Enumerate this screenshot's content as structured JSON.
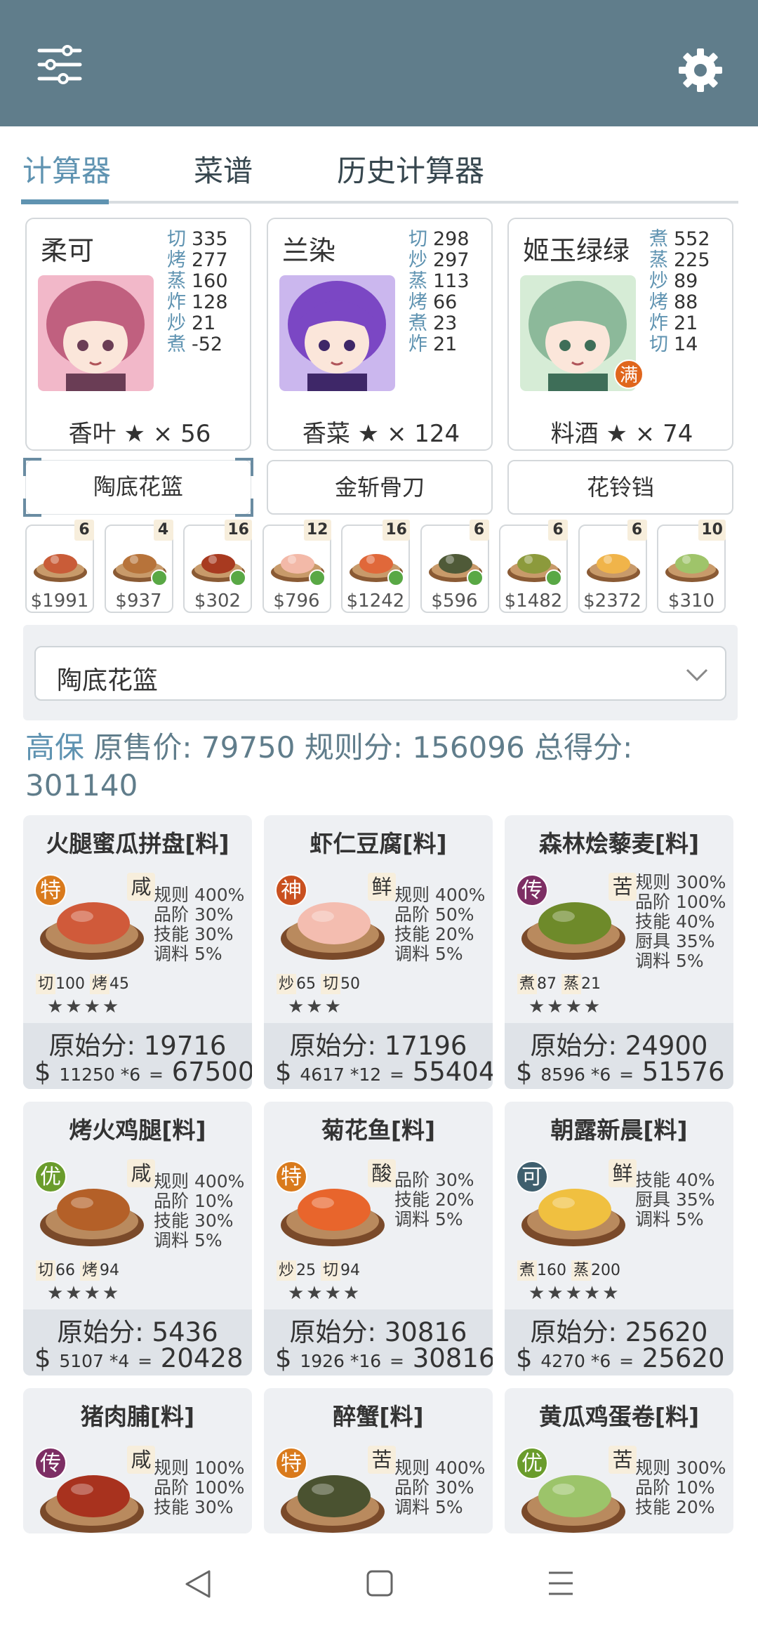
{
  "tabs": [
    "计算器",
    "菜谱",
    "历史计算器"
  ],
  "chefs": [
    {
      "name": "柔可",
      "skills": [
        [
          "切",
          "335"
        ],
        [
          "烤",
          "277"
        ],
        [
          "蒸",
          "160"
        ],
        [
          "炸",
          "128"
        ],
        [
          "炒",
          "21"
        ],
        [
          "煮",
          "-52"
        ]
      ],
      "bottom": "香叶 ★ × 56",
      "colors": [
        "#f2b8c9",
        "#c0607f",
        "#6a3d55"
      ]
    },
    {
      "name": "兰染",
      "skills": [
        [
          "切",
          "298"
        ],
        [
          "炒",
          "297"
        ],
        [
          "蒸",
          "113"
        ],
        [
          "烤",
          "66"
        ],
        [
          "煮",
          "23"
        ],
        [
          "炸",
          "21"
        ]
      ],
      "bottom": "香菜 ★ × 124",
      "colors": [
        "#cbb7ee",
        "#7b47c4",
        "#3e2768"
      ]
    },
    {
      "name": "姬玉绿绿",
      "skills": [
        [
          "煮",
          "552"
        ],
        [
          "蒸",
          "225"
        ],
        [
          "炒",
          "89"
        ],
        [
          "烤",
          "88"
        ],
        [
          "炸",
          "21"
        ],
        [
          "切",
          "14"
        ]
      ],
      "bottom": "料酒 ★ × 74",
      "colors": [
        "#d6ecd6",
        "#8cb99a",
        "#3e6e58"
      ],
      "badge": "满"
    }
  ],
  "tools": [
    "陶底花篮",
    "金斩骨刀",
    "花铃铛"
  ],
  "dishes": [
    {
      "count": "6",
      "price": "$1991",
      "color": "#c95c38",
      "ok": false
    },
    {
      "count": "4",
      "price": "$937",
      "color": "#b7733a",
      "ok": true
    },
    {
      "count": "16",
      "price": "$302",
      "color": "#a83a20",
      "ok": true
    },
    {
      "count": "12",
      "price": "$796",
      "color": "#f3b9a8",
      "ok": true
    },
    {
      "count": "16",
      "price": "$1242",
      "color": "#e0683a",
      "ok": true
    },
    {
      "count": "6",
      "price": "$596",
      "color": "#4f5a38",
      "ok": true
    },
    {
      "count": "6",
      "price": "$1482",
      "color": "#8c9a3c",
      "ok": true
    },
    {
      "count": "6",
      "price": "$2372",
      "color": "#f0b44a",
      "ok": false
    },
    {
      "count": "10",
      "price": "$310",
      "color": "#9fc46a",
      "ok": false
    }
  ],
  "select": {
    "value": "陶底花篮"
  },
  "summary": {
    "prefix": "高保",
    "orig_label": "原售价:",
    "orig": "79750",
    "rule_label": "规则分:",
    "rule": "156096",
    "total_label": "总得分:",
    "total": "301140"
  },
  "recipes": [
    {
      "title": "火腿蜜瓜拼盘[料]",
      "rarity": "特",
      "rcolor": "#d97a1c",
      "flavor": "咸",
      "bonus": [
        "规则 400%",
        "品阶 30%",
        "技能 30%",
        "调料 5%"
      ],
      "req": [
        [
          "切",
          "100"
        ],
        [
          "烤",
          "45"
        ]
      ],
      "stars": "★★★★",
      "orig": "原始分: 19716",
      "price": "11250 *6",
      "total": "67500",
      "color": "#d05a3a"
    },
    {
      "title": "虾仁豆腐[料]",
      "rarity": "神",
      "rcolor": "#c9501f",
      "flavor": "鲜",
      "bonus": [
        "规则 400%",
        "品阶 50%",
        "技能 20%",
        "调料 5%"
      ],
      "req": [
        [
          "炒",
          "65"
        ],
        [
          "切",
          "50"
        ]
      ],
      "stars": "★★★",
      "orig": "原始分: 17196",
      "price": "4617 *12",
      "total": "55404",
      "color": "#f4bdb0"
    },
    {
      "title": "森林烩藜麦[料]",
      "rarity": "传",
      "rcolor": "#7d2e64",
      "flavor": "苦",
      "bonus": [
        "规则 300%",
        "品阶 100%",
        "技能 40%",
        "厨具 35%",
        "调料 5%"
      ],
      "req": [
        [
          "煮",
          "87"
        ],
        [
          "蒸",
          "21"
        ]
      ],
      "stars": "★★★★",
      "orig": "原始分: 24900",
      "price": "8596 *6",
      "total": "51576",
      "color": "#6e8a2a"
    },
    {
      "title": "烤火鸡腿[料]",
      "rarity": "优",
      "rcolor": "#6a9c2c",
      "flavor": "咸",
      "bonus": [
        "规则 400%",
        "品阶 10%",
        "技能 30%",
        "调料 5%"
      ],
      "req": [
        [
          "切",
          "66"
        ],
        [
          "烤",
          "94"
        ]
      ],
      "stars": "★★★★",
      "orig": "原始分: 5436",
      "price": "5107 *4",
      "total": "20428",
      "color": "#b46028"
    },
    {
      "title": "菊花鱼[料]",
      "rarity": "特",
      "rcolor": "#d97a1c",
      "flavor": "酸",
      "bonus": [
        "品阶 30%",
        "技能 20%",
        "调料 5%"
      ],
      "req": [
        [
          "炒",
          "25"
        ],
        [
          "切",
          "94"
        ]
      ],
      "stars": "★★★★",
      "orig": "原始分: 30816",
      "price": "1926 *16",
      "total": "30816",
      "color": "#e8652c"
    },
    {
      "title": "朝露新晨[料]",
      "rarity": "可",
      "rcolor": "#3f5f6e",
      "flavor": "鲜",
      "bonus": [
        "技能 40%",
        "厨具 35%",
        "调料 5%"
      ],
      "req": [
        [
          "煮",
          "160"
        ],
        [
          "蒸",
          "200"
        ]
      ],
      "stars": "★★★★★",
      "orig": "原始分: 25620",
      "price": "4270 *6",
      "total": "25620",
      "color": "#f0c040"
    },
    {
      "title": "猪肉脯[料]",
      "rarity": "传",
      "rcolor": "#7d2e64",
      "flavor": "咸",
      "bonus": [
        "规则 100%",
        "品阶 100%",
        "技能 30%"
      ],
      "req": [],
      "stars": "",
      "orig": "",
      "price": "",
      "total": "",
      "color": "#a8321e"
    },
    {
      "title": "醉蟹[料]",
      "rarity": "特",
      "rcolor": "#d97a1c",
      "flavor": "苦",
      "bonus": [
        "规则 400%",
        "品阶 30%",
        "调料 5%"
      ],
      "req": [],
      "stars": "",
      "orig": "",
      "price": "",
      "total": "",
      "color": "#4a5230"
    },
    {
      "title": "黄瓜鸡蛋卷[料]",
      "rarity": "优",
      "rcolor": "#6a9c2c",
      "flavor": "苦",
      "bonus": [
        "规则 300%",
        "品阶 10%",
        "技能 20%"
      ],
      "req": [],
      "stars": "",
      "orig": "",
      "price": "",
      "total": "",
      "color": "#9cc46a"
    }
  ]
}
